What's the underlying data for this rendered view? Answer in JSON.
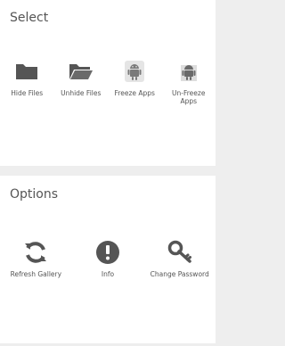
{
  "select": {
    "title": "Select",
    "items": [
      {
        "label": "Hide Files",
        "icon": "folder-icon"
      },
      {
        "label": "Unhide Files",
        "icon": "open-folder-icon"
      },
      {
        "label": "Freeze Apps",
        "icon": "android-freeze-icon"
      },
      {
        "label": "Un-Freeze\nApps",
        "icon": "android-unfreeze-icon"
      }
    ]
  },
  "options": {
    "title": "Options",
    "items": [
      {
        "label": "Refresh Gallery",
        "icon": "refresh-icon"
      },
      {
        "label": "Info",
        "icon": "info-icon"
      },
      {
        "label": "Change Password",
        "icon": "key-icon"
      }
    ]
  },
  "colors": {
    "icon": "#555555",
    "background": "#eeeeee",
    "card": "#ffffff"
  }
}
